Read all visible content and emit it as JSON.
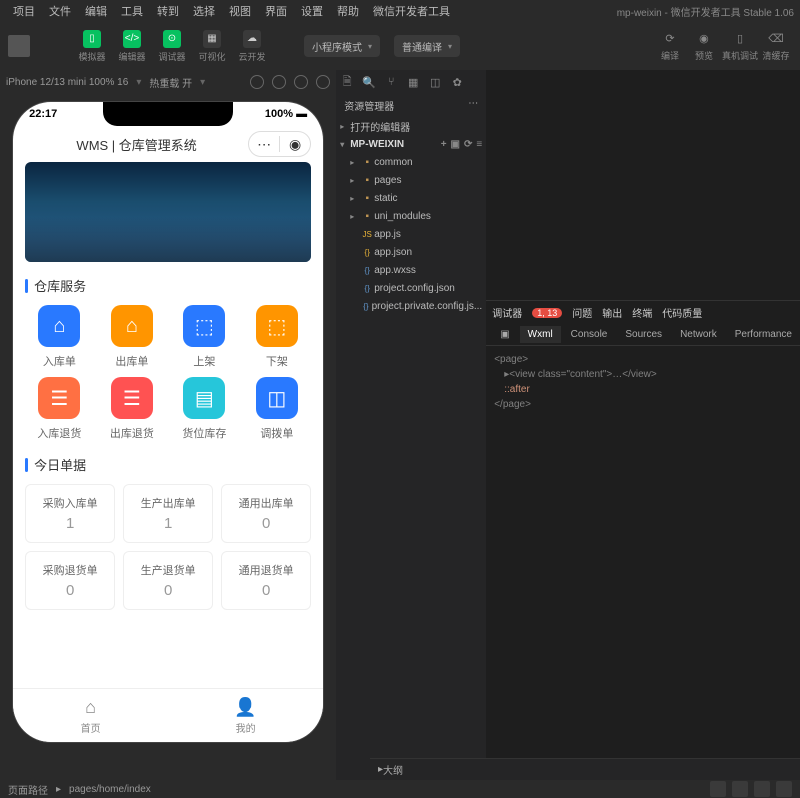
{
  "app": {
    "project": "mp-weixin",
    "suffix": "微信开发者工具 Stable 1.06"
  },
  "menu": [
    "项目",
    "文件",
    "编辑",
    "工具",
    "转到",
    "选择",
    "视图",
    "界面",
    "设置",
    "帮助",
    "微信开发者工具"
  ],
  "toolbar": {
    "sim": "模拟器",
    "editor": "编辑器",
    "debug": "调试器",
    "visual": "可视化",
    "cloud": "云开发",
    "mode": "小程序模式",
    "compileMode": "普通编译",
    "compile": "编译",
    "preview": "预览",
    "realdev": "真机调试",
    "clearcache": "清缓存"
  },
  "simbar": {
    "device": "iPhone 12/13 mini 100% 16",
    "hot": "热重载 开"
  },
  "phone": {
    "time": "22:17",
    "battery": "100%",
    "nav": "WMS | 仓库管理系统",
    "section1": "仓库服务",
    "grid": [
      {
        "label": "入库单",
        "color": "#2979ff",
        "icon": "⌂"
      },
      {
        "label": "出库单",
        "color": "#ff9500",
        "icon": "⌂"
      },
      {
        "label": "上架",
        "color": "#2979ff",
        "icon": "⬚"
      },
      {
        "label": "下架",
        "color": "#ff9500",
        "icon": "⬚"
      },
      {
        "label": "入库退货",
        "color": "#ff7043",
        "icon": "☰"
      },
      {
        "label": "出库退货",
        "color": "#ff5252",
        "icon": "☰"
      },
      {
        "label": "货位库存",
        "color": "#26c6da",
        "icon": "▤"
      },
      {
        "label": "调拨单",
        "color": "#2979ff",
        "icon": "◫"
      }
    ],
    "section2": "今日单据",
    "cards": [
      {
        "title": "采购入库单",
        "value": "1"
      },
      {
        "title": "生产出库单",
        "value": "1"
      },
      {
        "title": "通用出库单",
        "value": "0"
      },
      {
        "title": "采购退货单",
        "value": "0"
      },
      {
        "title": "生产退货单",
        "value": "0"
      },
      {
        "title": "通用退货单",
        "value": "0"
      }
    ],
    "tabs": [
      {
        "icon": "⌂",
        "label": "首页"
      },
      {
        "icon": "👤",
        "label": "我的"
      }
    ]
  },
  "explorer": {
    "title": "资源管理器",
    "openEditors": "打开的编辑器",
    "project": "MP-WEIXIN",
    "folders": [
      "common",
      "pages",
      "static",
      "uni_modules"
    ],
    "files": [
      {
        "name": "app.js",
        "icon": "JS",
        "color": "#e8b339"
      },
      {
        "name": "app.json",
        "icon": "{}",
        "color": "#e8b339"
      },
      {
        "name": "app.wxss",
        "icon": "{}",
        "color": "#6196cc"
      },
      {
        "name": "project.config.json",
        "icon": "{}",
        "color": "#6196cc"
      },
      {
        "name": "project.private.config.js...",
        "icon": "{}",
        "color": "#6196cc"
      }
    ]
  },
  "debugger": {
    "title": "调试器",
    "badge": "1, 13",
    "toptabs": [
      "问题",
      "输出",
      "终端",
      "代码质量"
    ],
    "tabs": [
      "Wxml",
      "Console",
      "Sources",
      "Network",
      "Performance"
    ],
    "dom": {
      "l1": "<page>",
      "l2": "▸<view class=\"content\">…</view>",
      "l3": "::after",
      "l4": "</page>"
    }
  },
  "outline": "大纲",
  "footer": {
    "path_label": "页面路径",
    "path": "pages/home/index"
  }
}
